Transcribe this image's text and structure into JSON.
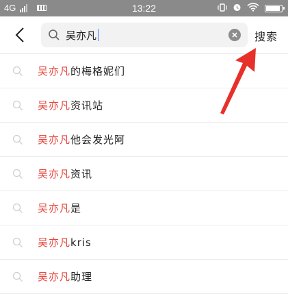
{
  "status_bar": {
    "network": "4G",
    "time": "13:22"
  },
  "search": {
    "query": "吴亦凡",
    "search_label": "搜索"
  },
  "suggestions": [
    {
      "highlight": "吴亦凡",
      "rest": "的梅格妮们"
    },
    {
      "highlight": "吴亦凡",
      "rest": "资讯站"
    },
    {
      "highlight": "吴亦凡",
      "rest": "他会发光阿"
    },
    {
      "highlight": "吴亦凡",
      "rest": "资讯"
    },
    {
      "highlight": "吴亦凡",
      "rest": "是"
    },
    {
      "highlight": "吴亦凡",
      "rest": "kris"
    },
    {
      "highlight": "吴亦凡",
      "rest": "助理"
    }
  ],
  "colors": {
    "highlight": "#e8463c",
    "annotation_arrow": "#e8302a"
  }
}
